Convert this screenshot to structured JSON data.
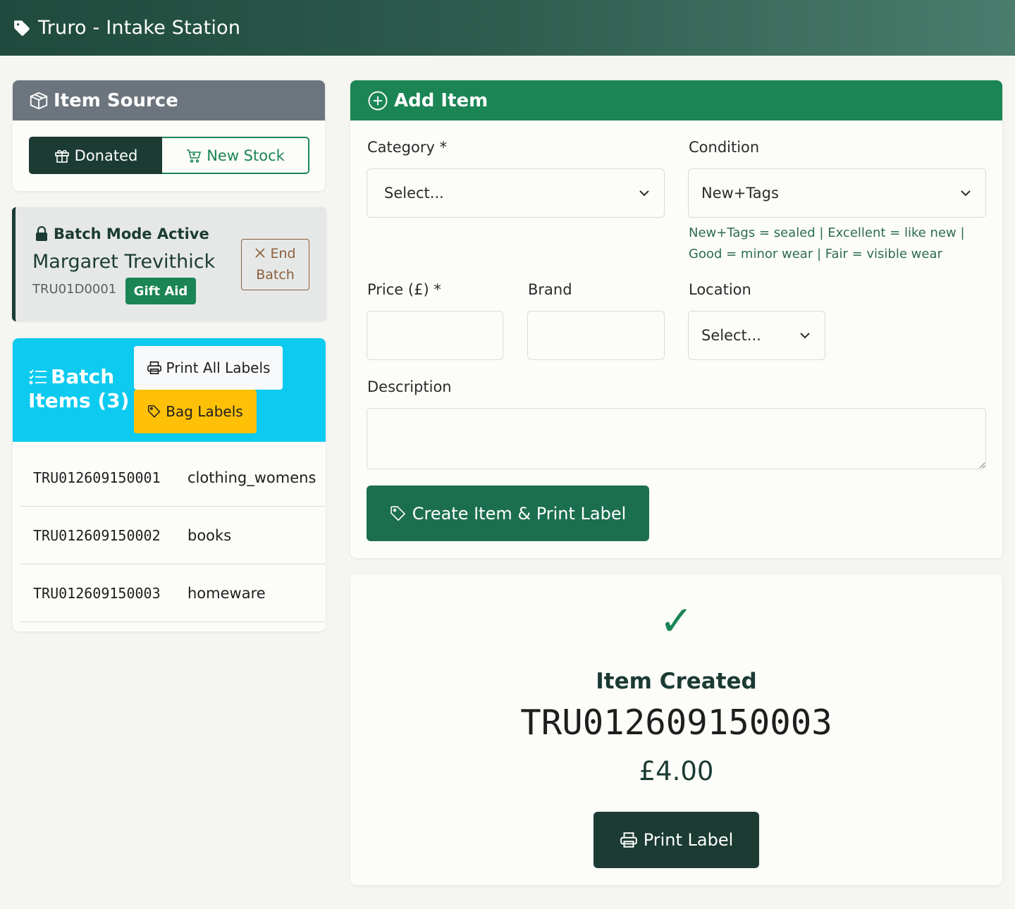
{
  "header": {
    "title": "Truro - Intake Station",
    "icon": "tag-icon"
  },
  "item_source": {
    "title": "Item Source",
    "options": [
      {
        "label": "Donated",
        "icon": "gift-icon",
        "selected": true
      },
      {
        "label": "New Stock",
        "icon": "cart-icon",
        "selected": false
      }
    ]
  },
  "batch_mode": {
    "title": "Batch Mode Active",
    "donor_name": "Margaret Trevithick",
    "donor_id": "TRU01D0001",
    "badge": "Gift Aid",
    "end_button_line1": "End",
    "end_button_line2": "Batch"
  },
  "batch_items": {
    "title_line1": "Batch",
    "title_line2": "Items (3)",
    "print_all_label": "Print All Labels",
    "bag_labels_label": "Bag Labels",
    "rows": [
      {
        "code": "TRU012609150001",
        "category": "clothing_womens"
      },
      {
        "code": "TRU012609150002",
        "category": "books"
      },
      {
        "code": "TRU012609150003",
        "category": "homeware"
      }
    ]
  },
  "add_item": {
    "title": "Add Item",
    "category_label": "Category *",
    "category_value": "Select...",
    "condition_label": "Condition",
    "condition_value": "New+Tags",
    "condition_hint": "New+Tags = sealed | Excellent = like new | Good = minor wear | Fair = visible wear",
    "price_label": "Price (£) *",
    "price_value": "",
    "brand_label": "Brand",
    "brand_value": "",
    "location_label": "Location",
    "location_value": "Select...",
    "description_label": "Description",
    "description_value": "",
    "create_button": "Create Item & Print Label"
  },
  "item_created": {
    "check": "✓",
    "title": "Item Created",
    "code": "TRU012609150003",
    "price": "£4.00",
    "print_button": "Print Label"
  },
  "colors": {
    "header_dark": "#1f4a3d",
    "primary_green": "#1b8555",
    "dark_green": "#1b3b33",
    "batch_items_blue": "#0dcaf0",
    "bag_yellow": "#ffc107",
    "source_gray": "#6c757d",
    "end_batch_brown": "#8b5e3c"
  }
}
